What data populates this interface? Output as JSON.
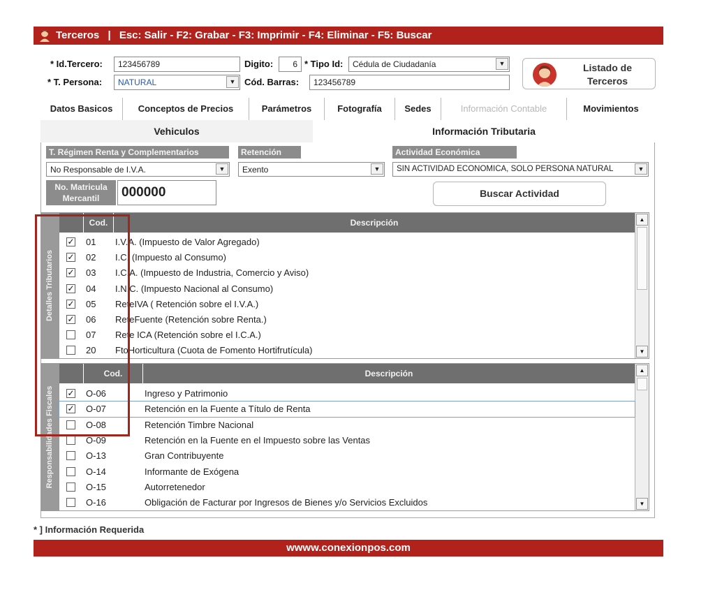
{
  "title_bar": {
    "module": "Terceros",
    "separator": "|",
    "shortcuts": "Esc: Salir - F2: Grabar - F3: Imprimir - F4: Eliminar - F5: Buscar"
  },
  "header_form": {
    "id_tercero_label": "* Id.Tercero:",
    "id_tercero_value": "123456789",
    "digito_label": "Digito:",
    "digito_value": "6",
    "tipo_id_label": "* Tipo Id:",
    "tipo_id_value": "Cédula de Ciudadanía",
    "tipo_persona_label": "* T. Persona:",
    "tipo_persona_value": "NATURAL",
    "cod_barras_label": "Cód. Barras:",
    "cod_barras_value": "123456789",
    "listado_line1": "Listado de",
    "listado_line2": "Terceros"
  },
  "tabs": [
    {
      "label": "Datos Basicos"
    },
    {
      "label": "Conceptos de Precios"
    },
    {
      "label": "Parámetros"
    },
    {
      "label": "Fotografía"
    },
    {
      "label": "Sedes"
    },
    {
      "label": "Información Contable"
    },
    {
      "label": "Movimientos"
    }
  ],
  "subtabs": {
    "vehiculos": "Vehiculos",
    "info_tributaria": "Información Tributaria"
  },
  "tributaria": {
    "regimen_label": "T. Régimen Renta y Complementarios",
    "regimen_value": "No Responsable de I.V.A.",
    "retencion_label": "Retención",
    "retencion_value": "Exento",
    "actividad_label": "Actividad Económica",
    "actividad_value": "SIN ACTIVIDAD ECONOMICA, SOLO PERSONA NATURAL",
    "matricula_label_1": "No. Matricula",
    "matricula_label_2": "Mercantil",
    "matricula_value": "000000",
    "buscar_actividad": "Buscar Actividad"
  },
  "detalles_tributarios": {
    "side_label": "Detalles Tributarios",
    "col_cod": "Cod.",
    "col_desc": "Descripción",
    "rows": [
      {
        "checked": true,
        "cod": "01",
        "desc": "I.V.A. (Impuesto de Valor Agregado)"
      },
      {
        "checked": true,
        "cod": "02",
        "desc": "I.C. (Impuesto al Consumo)"
      },
      {
        "checked": true,
        "cod": "03",
        "desc": "I.C.A. (Impuesto de Industria, Comercio y Aviso)"
      },
      {
        "checked": true,
        "cod": "04",
        "desc": "I.N.C. (Impuesto Nacional al Consumo)"
      },
      {
        "checked": true,
        "cod": "05",
        "desc": "ReteIVA ( Retención sobre el I.V.A.)"
      },
      {
        "checked": true,
        "cod": "06",
        "desc": "ReteFuente (Retención sobre Renta.)"
      },
      {
        "checked": false,
        "cod": "07",
        "desc": "Rete ICA (Retención sobre el I.C.A.)"
      },
      {
        "checked": false,
        "cod": "20",
        "desc": "FtoHorticultura (Cuota de Fomento  Hortifrutícula)"
      }
    ]
  },
  "responsabilidades_fiscales": {
    "side_label": "Responsabilidades Fiscales",
    "col_cod": "Cod.",
    "col_desc": "Descripción",
    "rows": [
      {
        "checked": true,
        "cod": "O-06",
        "desc": "Ingreso y Patrimonio"
      },
      {
        "checked": true,
        "cod": "O-07",
        "desc": "Retención en la Fuente a Título de Renta"
      },
      {
        "checked": false,
        "cod": "O-08",
        "desc": "Retención Timbre Nacional"
      },
      {
        "checked": false,
        "cod": "O-09",
        "desc": "Retención en la Fuente en el Impuesto sobre las Ventas"
      },
      {
        "checked": false,
        "cod": "O-13",
        "desc": "Gran Contribuyente"
      },
      {
        "checked": false,
        "cod": "O-14",
        "desc": "Informante de Exógena"
      },
      {
        "checked": false,
        "cod": "O-15",
        "desc": "Autorretenedor"
      },
      {
        "checked": false,
        "cod": "O-16",
        "desc": "Obligación de Facturar por Ingresos de Bienes y/o Servicios Excluidos"
      }
    ]
  },
  "required_note": "* ] Información Requerida",
  "footer_url": "wwww.conexionpos.com",
  "colors": {
    "brand_red": "#b2221c",
    "header_gray": "#6f6f6f",
    "highlight_box": "#a3231d"
  }
}
